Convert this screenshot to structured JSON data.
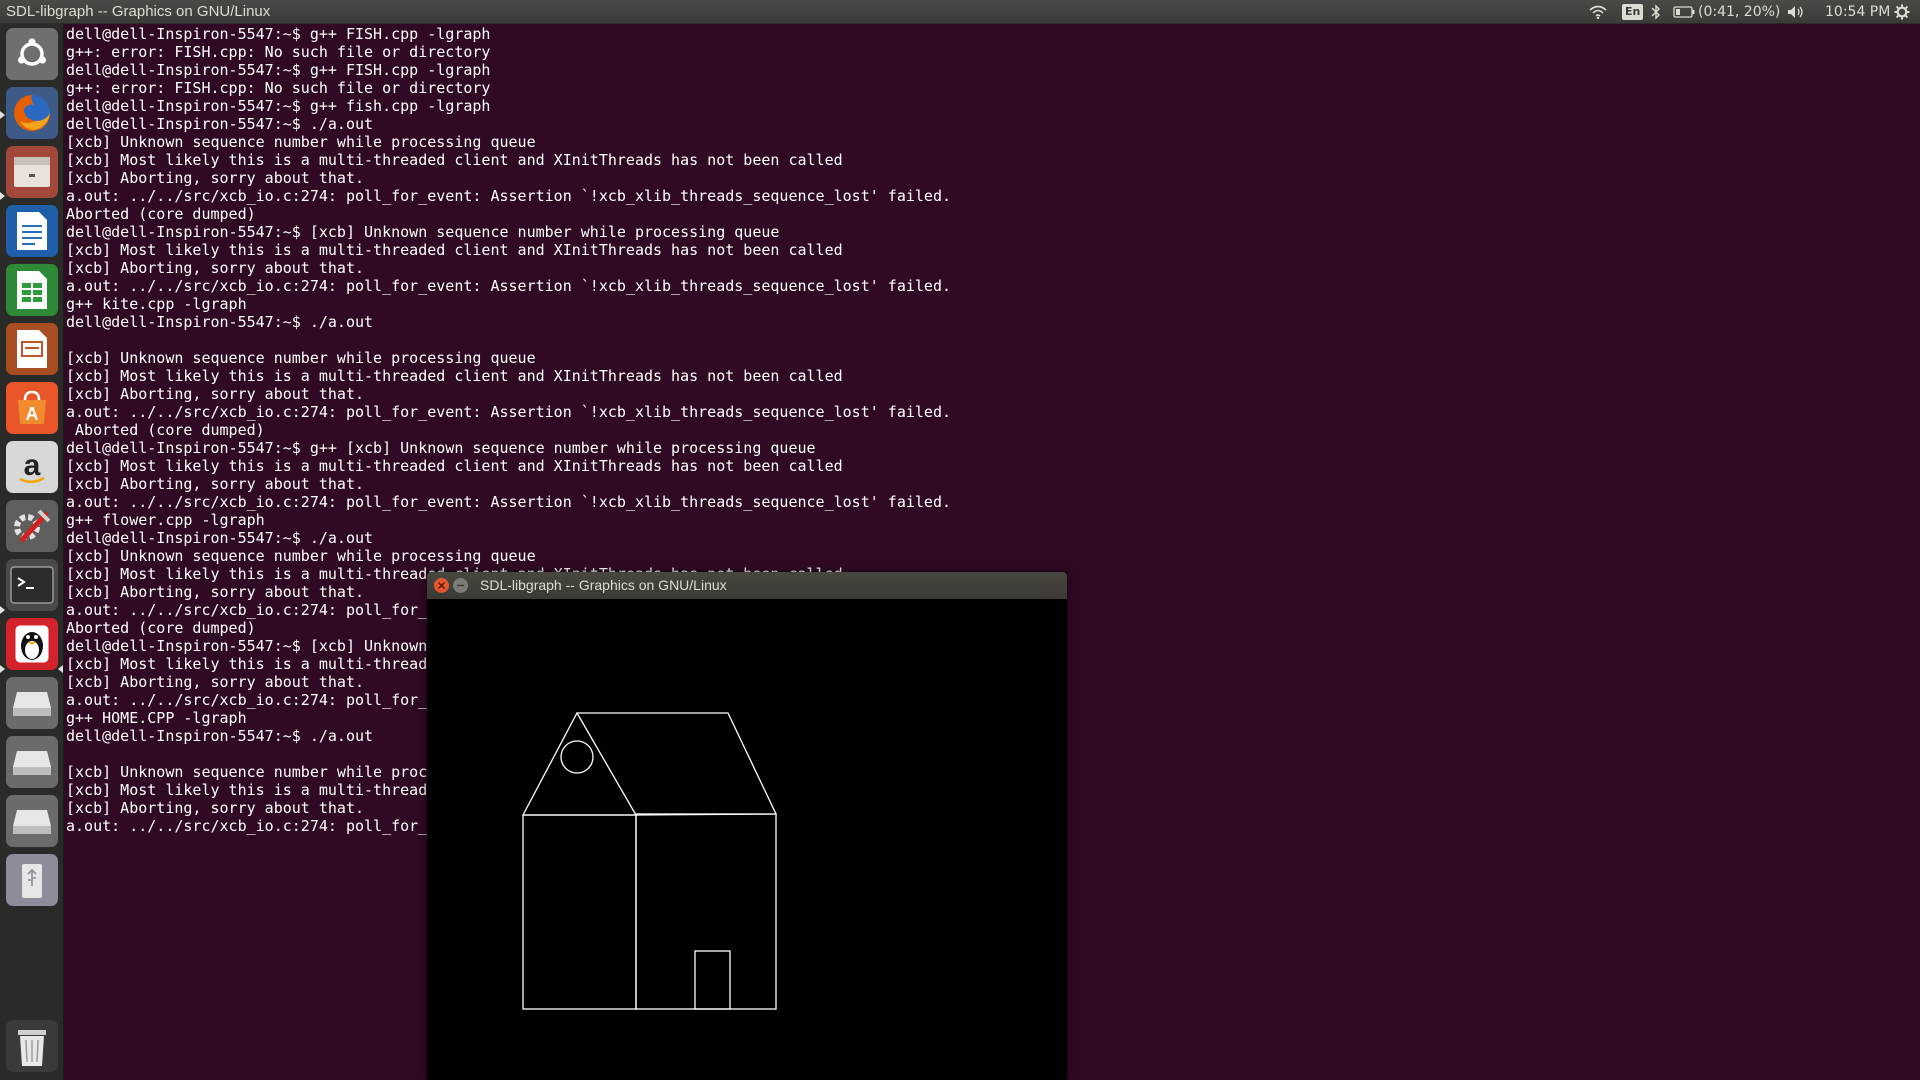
{
  "topbar": {
    "app_title": "SDL-libgraph -- Graphics on GNU/Linux",
    "keyboard_layout": "En",
    "battery_status": "(0:41, 20%)",
    "clock": "10:54 PM",
    "icons": [
      "wifi-icon",
      "keyboard-layout-indicator",
      "bluetooth-icon",
      "battery-icon",
      "volume-icon",
      "settings-gear-icon"
    ]
  },
  "launcher": {
    "items": [
      {
        "name": "ubuntu-dash-icon",
        "color": "#7a7a7a"
      },
      {
        "name": "firefox-icon",
        "color": "#e66000"
      },
      {
        "name": "files-icon",
        "color": "#b84b3a"
      },
      {
        "name": "libreoffice-writer-icon",
        "color": "#2a6fb5"
      },
      {
        "name": "libreoffice-calc-icon",
        "color": "#2e9c3c"
      },
      {
        "name": "libreoffice-impress-icon",
        "color": "#c0572a"
      },
      {
        "name": "ubuntu-software-icon",
        "color": "#e8562a"
      },
      {
        "name": "amazon-icon",
        "color": "#dcdcdc"
      },
      {
        "name": "system-settings-icon",
        "color": "#6a6a6a"
      },
      {
        "name": "terminal-icon",
        "color": "#3a3a3a"
      },
      {
        "name": "turbo-c-penguin-icon",
        "color": "#d3242b"
      },
      {
        "name": "drive-icon",
        "color": "#bdbdbd"
      },
      {
        "name": "drive-icon",
        "color": "#bdbdbd"
      },
      {
        "name": "drive-icon",
        "color": "#bdbdbd"
      },
      {
        "name": "usb-drive-icon",
        "color": "#8c8c9a"
      },
      {
        "name": "trash-icon",
        "color": "#a0a0a0"
      }
    ]
  },
  "terminal": {
    "lines": [
      "dell@dell-Inspiron-5547:~$ g++ FISH.cpp -lgraph",
      "g++: error: FISH.cpp: No such file or directory",
      "dell@dell-Inspiron-5547:~$ g++ FISH.cpp -lgraph",
      "g++: error: FISH.cpp: No such file or directory",
      "dell@dell-Inspiron-5547:~$ g++ fish.cpp -lgraph",
      "dell@dell-Inspiron-5547:~$ ./a.out",
      "[xcb] Unknown sequence number while processing queue",
      "[xcb] Most likely this is a multi-threaded client and XInitThreads has not been called",
      "[xcb] Aborting, sorry about that.",
      "a.out: ../../src/xcb_io.c:274: poll_for_event: Assertion `!xcb_xlib_threads_sequence_lost' failed.",
      "Aborted (core dumped)",
      "dell@dell-Inspiron-5547:~$ [xcb] Unknown sequence number while processing queue",
      "[xcb] Most likely this is a multi-threaded client and XInitThreads has not been called",
      "[xcb] Aborting, sorry about that.",
      "a.out: ../../src/xcb_io.c:274: poll_for_event: Assertion `!xcb_xlib_threads_sequence_lost' failed.",
      "g++ kite.cpp -lgraph",
      "dell@dell-Inspiron-5547:~$ ./a.out",
      "",
      "[xcb] Unknown sequence number while processing queue",
      "[xcb] Most likely this is a multi-threaded client and XInitThreads has not been called",
      "[xcb] Aborting, sorry about that.",
      "a.out: ../../src/xcb_io.c:274: poll_for_event: Assertion `!xcb_xlib_threads_sequence_lost' failed.",
      " Aborted (core dumped)",
      "dell@dell-Inspiron-5547:~$ g++ [xcb] Unknown sequence number while processing queue",
      "[xcb] Most likely this is a multi-threaded client and XInitThreads has not been called",
      "[xcb] Aborting, sorry about that.",
      "a.out: ../../src/xcb_io.c:274: poll_for_event: Assertion `!xcb_xlib_threads_sequence_lost' failed.",
      "g++ flower.cpp -lgraph",
      "dell@dell-Inspiron-5547:~$ ./a.out",
      "[xcb] Unknown sequence number while processing queue",
      "[xcb] Most likely this is a multi-threaded client and XInitThreads has not been called",
      "[xcb] Aborting, sorry about that.",
      "a.out: ../../src/xcb_io.c:274: poll_for_",
      "Aborted (core dumped)",
      "dell@dell-Inspiron-5547:~$ [xcb] Unknown",
      "[xcb] Most likely this is a multi-thread",
      "[xcb] Aborting, sorry about that.",
      "a.out: ../../src/xcb_io.c:274: poll_for_",
      "g++ HOME.CPP -lgraph",
      "dell@dell-Inspiron-5547:~$ ./a.out",
      "",
      "[xcb] Unknown sequence number while proc",
      "[xcb] Most likely this is a multi-thread",
      "[xcb] Aborting, sorry about that.",
      "a.out: ../../src/xcb_io.c:274: poll_for_"
    ]
  },
  "graphics_window": {
    "title": "SDL-libgraph -- Graphics on GNU/Linux",
    "drawing": "house-outline"
  },
  "colors": {
    "terminal_bg": "#300a24",
    "close_button": "#e4572e",
    "minimize_button": "#7c7b75"
  }
}
